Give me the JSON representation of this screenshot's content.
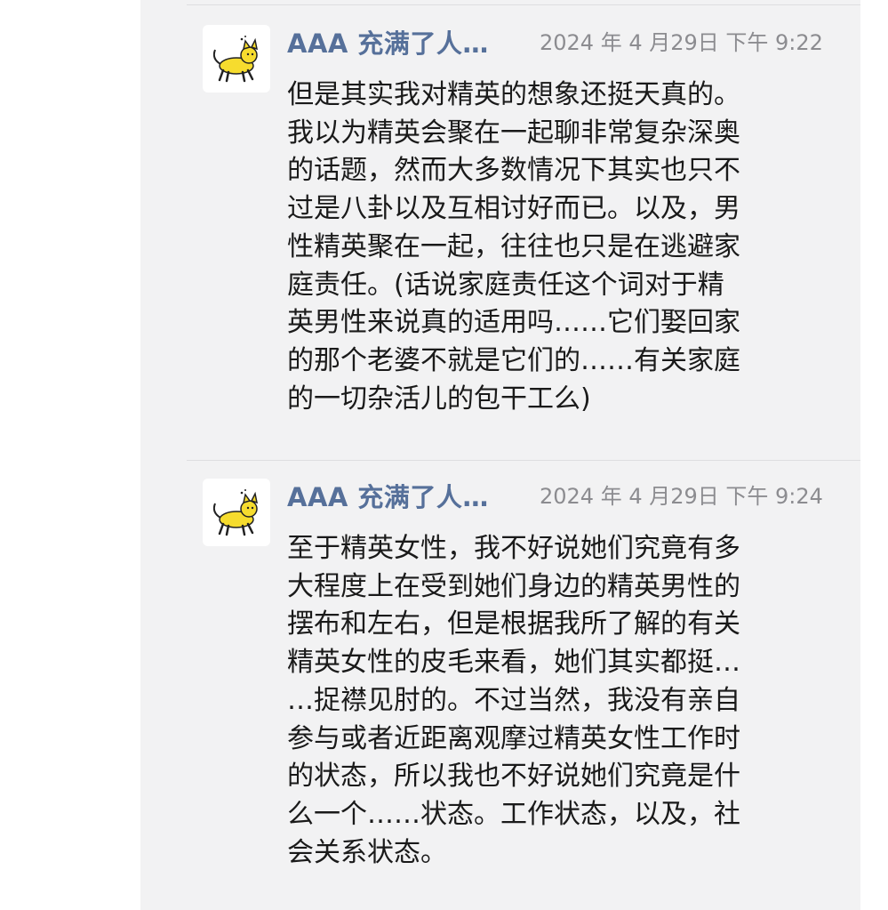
{
  "comments": [
    {
      "author": "AAA 充满了人…",
      "time": "2024 年 4 月29日 下午 9:22",
      "avatar_icon": "yellow-cat-icon",
      "lines": [
        "但是其实我对精英的想象还挺天真的。",
        "我以为精英会聚在一起聊非常复杂深奥",
        "的话题，然而大多数情况下其实也只不",
        "过是八卦以及互相讨好而已。以及，男",
        "性精英聚在一起，往往也只是在逃避家",
        "庭责任。(话说家庭责任这个词对于精",
        "英男性来说真的适用吗……它们娶回家",
        "的那个老婆不就是它们的……有关家庭",
        "的一切杂活儿的包干工么)"
      ]
    },
    {
      "author": "AAA 充满了人…",
      "time": "2024 年 4 月29日 下午 9:24",
      "avatar_icon": "yellow-cat-icon",
      "lines": [
        "至于精英女性，我不好说她们究竟有多",
        "大程度上在受到她们身边的精英男性的",
        "摆布和左右，但是根据我所了解的有关",
        "精英女性的皮毛来看，她们其实都挺…",
        "…捉襟见肘的。不过当然，我没有亲自",
        "参与或者近距离观摩过精英女性工作时",
        "的状态，所以我也不好说她们究竟是什",
        "么一个……状态。工作状态，以及，社",
        "会关系状态。"
      ]
    }
  ],
  "colors": {
    "author": "#56709a",
    "time": "#8c8c90",
    "panel": "#f2f2f3",
    "cat": "#f6dc2e"
  }
}
